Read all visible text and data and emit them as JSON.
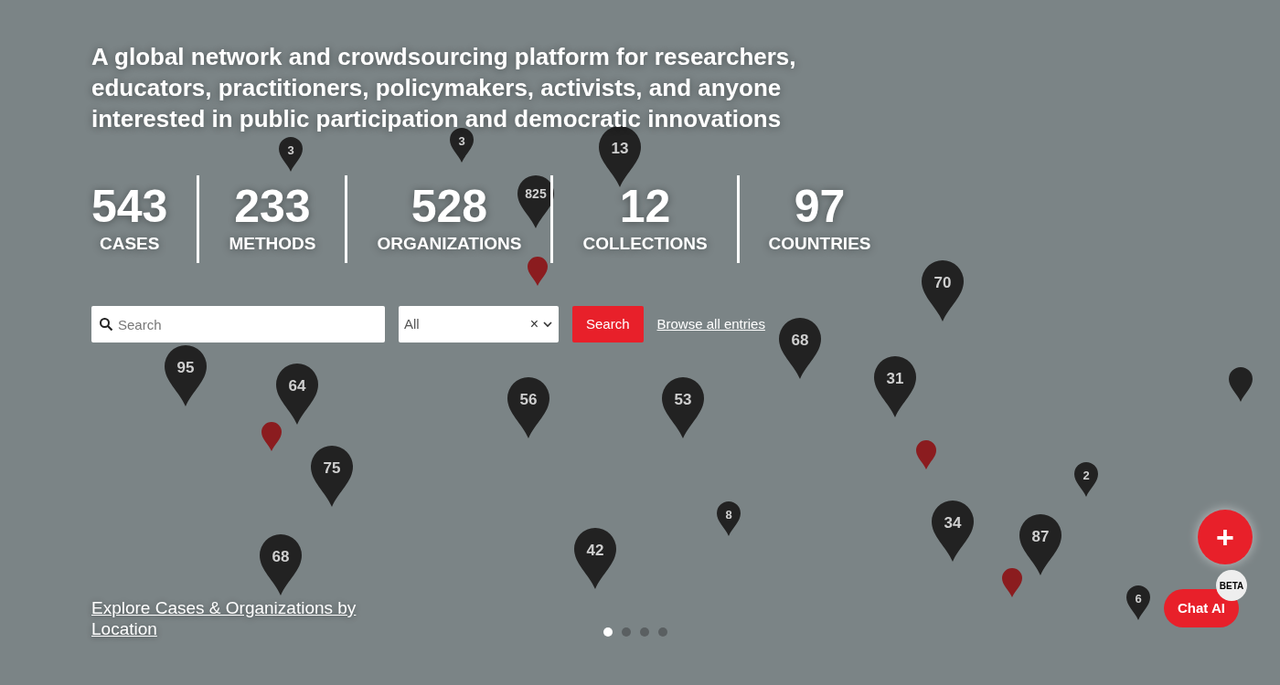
{
  "headline": "A global network and crowdsourcing platform for researchers, educators, practitioners, policymakers, activists, and anyone interested in public participation and democratic innovations",
  "stats": [
    {
      "value": "543",
      "label": "CASES"
    },
    {
      "value": "233",
      "label": "METHODS"
    },
    {
      "value": "528",
      "label": "ORGANIZATIONS"
    },
    {
      "value": "12",
      "label": "COLLECTIONS"
    },
    {
      "value": "97",
      "label": "COUNTRIES"
    }
  ],
  "search": {
    "placeholder": "Search",
    "filter_value": "All",
    "clear_icon": "×",
    "button": "Search",
    "browse_link": "Browse all entries"
  },
  "map_pins": [
    {
      "kind": "cluster",
      "label": "3"
    },
    {
      "kind": "cluster",
      "label": "3"
    },
    {
      "kind": "cluster",
      "label": "13"
    },
    {
      "kind": "cluster",
      "label": "825"
    },
    {
      "kind": "marker",
      "color": "#8b1c1f"
    },
    {
      "kind": "cluster",
      "label": "95"
    },
    {
      "kind": "cluster",
      "label": "64"
    },
    {
      "kind": "marker",
      "color": "#8b1c1f"
    },
    {
      "kind": "cluster",
      "label": "75"
    },
    {
      "kind": "cluster",
      "label": "68"
    },
    {
      "kind": "cluster",
      "label": "56"
    },
    {
      "kind": "cluster",
      "label": "42"
    },
    {
      "kind": "cluster",
      "label": "53"
    },
    {
      "kind": "cluster",
      "label": "68"
    },
    {
      "kind": "cluster",
      "label": "70"
    },
    {
      "kind": "cluster",
      "label": "31"
    },
    {
      "kind": "cluster",
      "label": "8"
    },
    {
      "kind": "marker",
      "color": "#8b1c1f"
    },
    {
      "kind": "cluster",
      "label": "2"
    },
    {
      "kind": "cluster",
      "label": "34"
    },
    {
      "kind": "cluster",
      "label": "87"
    },
    {
      "kind": "marker",
      "color": "#8b1c1f"
    },
    {
      "kind": "cluster",
      "label": "6"
    },
    {
      "kind": "marker",
      "color": "#222222"
    }
  ],
  "explore_link": "Explore Cases & Organizations by Location",
  "carousel_dots": [
    {
      "selected": true
    },
    {
      "selected": false
    },
    {
      "selected": false
    },
    {
      "selected": false
    }
  ],
  "add_button": "+",
  "chat_button": {
    "label": "Chat AI",
    "badge": "BETA"
  }
}
